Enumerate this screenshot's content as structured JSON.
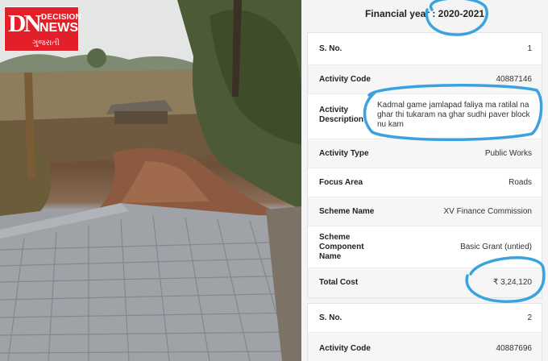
{
  "logo": {
    "monogram": "DN",
    "line1": "DECISION",
    "line2": "NEWS",
    "line3": "ગુજરાતી"
  },
  "financial_year": "Financial year : 2020-2021",
  "cards": [
    {
      "rows": [
        {
          "label": "S. No.",
          "value": "1"
        },
        {
          "label": "Activity Code",
          "value": "40887146"
        },
        {
          "label": "Activity Description",
          "value": "Kadmal game jamlapad faliya ma ratilal na ghar thi tukaram na ghar sudhi paver block nu kam"
        },
        {
          "label": "Activity Type",
          "value": "Public Works"
        },
        {
          "label": "Focus Area",
          "value": "Roads"
        },
        {
          "label": "Scheme Name",
          "value": "XV Finance Commission"
        },
        {
          "label": "Scheme Component Name",
          "value": "Basic Grant (untied)"
        },
        {
          "label": "Total Cost",
          "value": "₹ 3,24,120"
        }
      ]
    },
    {
      "rows": [
        {
          "label": "S. No.",
          "value": "2"
        },
        {
          "label": "Activity Code",
          "value": "40887696"
        }
      ]
    }
  ],
  "colors": {
    "marker": "#3aa3df",
    "logo_red": "#e3202a"
  }
}
